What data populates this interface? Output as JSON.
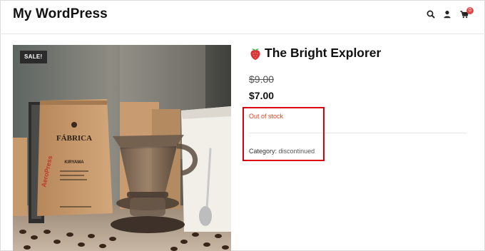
{
  "header": {
    "site_title": "My WordPress",
    "cart_count": "0",
    "icons": [
      "search-icon",
      "user-icon",
      "cart-icon"
    ]
  },
  "product": {
    "sale_badge": "SALE!",
    "emoji": "🍓",
    "title": "The Bright Explorer",
    "price_old": "$9.00",
    "price_new": "$7.00",
    "stock_status": "Out of stock",
    "category_label": "Category:",
    "category_value": "discontinued",
    "image_text": {
      "bag_brand": "FÁBRICA",
      "bag_subtitle": "KIRYAMA",
      "aeropress": "AeroPress"
    }
  },
  "colors": {
    "accent_red": "#d9000f",
    "stock_red": "#e2401c",
    "badge_red": "#e34848"
  }
}
